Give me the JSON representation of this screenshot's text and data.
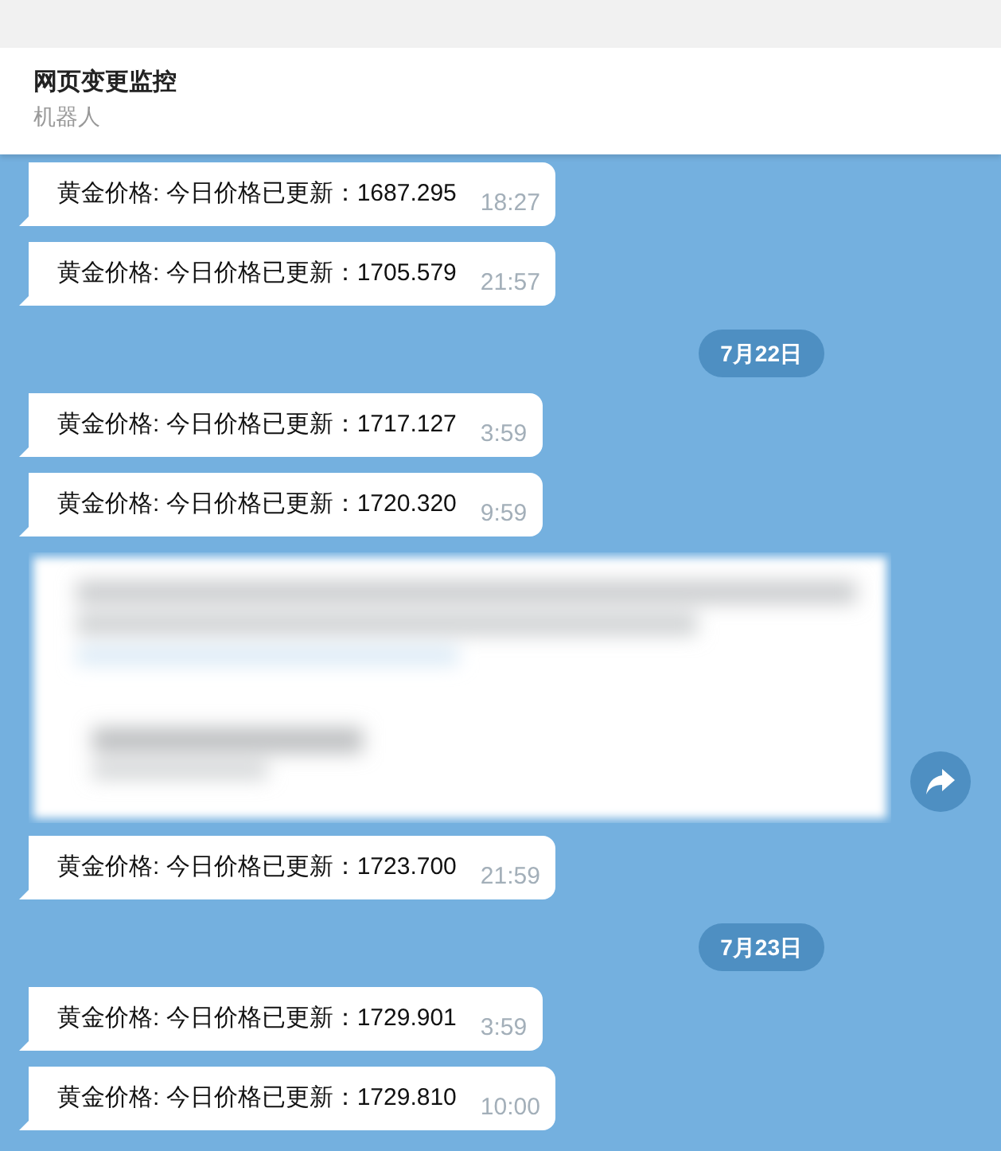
{
  "header": {
    "title": "网页变更监控",
    "subtitle": "机器人"
  },
  "items": [
    {
      "kind": "message",
      "text": "黄金价格: 今日价格已更新：1687.295",
      "time": "18:27",
      "forward_button": false
    },
    {
      "kind": "message",
      "text": "黄金价格: 今日价格已更新：1705.579",
      "time": "21:57",
      "forward_button": false
    },
    {
      "kind": "date",
      "text": "7月22日",
      "forward_button": false
    },
    {
      "kind": "message",
      "text": "黄金价格: 今日价格已更新：1717.127",
      "time": "3:59",
      "forward_button": false
    },
    {
      "kind": "message",
      "text": "黄金价格: 今日价格已更新：1720.320",
      "time": "9:59",
      "forward_button": false
    },
    {
      "kind": "blurred",
      "forward_button": true
    },
    {
      "kind": "message",
      "text": "黄金价格: 今日价格已更新：1723.700",
      "time": "21:59",
      "forward_button": false
    },
    {
      "kind": "date",
      "text": "7月23日",
      "forward_button": false
    },
    {
      "kind": "message",
      "text": "黄金价格: 今日价格已更新：1729.901",
      "time": "3:59",
      "forward_button": false
    },
    {
      "kind": "message",
      "text": "黄金价格: 今日价格已更新：1729.810",
      "time": "10:00",
      "forward_button": false
    }
  ]
}
